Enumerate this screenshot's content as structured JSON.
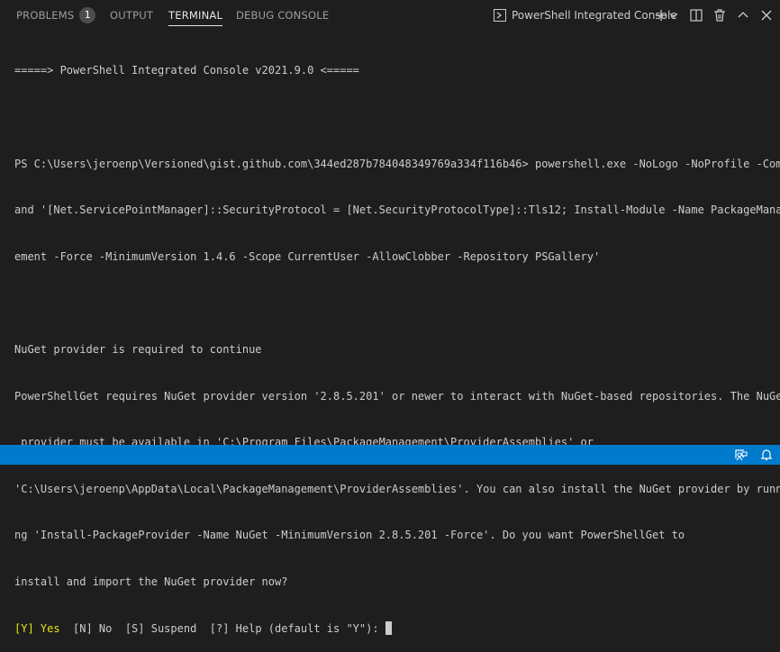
{
  "panel": {
    "tabs": [
      {
        "label": "PROBLEMS",
        "badge": "1"
      },
      {
        "label": "OUTPUT"
      },
      {
        "label": "TERMINAL"
      },
      {
        "label": "DEBUG CONSOLE"
      }
    ],
    "active_tab": "TERMINAL",
    "terminal_select": "PowerShell Integrated Console",
    "actions": [
      "new-terminal-icon",
      "chevron-down-icon",
      "split-terminal-icon",
      "trash-icon",
      "maximize-panel-icon",
      "close-icon"
    ]
  },
  "terminal": {
    "lines": [
      "=====> PowerShell Integrated Console v2021.9.0 <=====",
      "",
      "PS C:\\Users\\jeroenp\\Versioned\\gist.github.com\\344ed287b784048349769a334f116b46> powershell.exe -NoLogo -NoProfile -Comm",
      "and '[Net.ServicePointManager]::SecurityProtocol = [Net.SecurityProtocolType]::Tls12; Install-Module -Name PackageManag",
      "ement -Force -MinimumVersion 1.4.6 -Scope CurrentUser -AllowClobber -Repository PSGallery'",
      "",
      "NuGet provider is required to continue",
      "PowerShellGet requires NuGet provider version '2.8.5.201' or newer to interact with NuGet-based repositories. The NuGet",
      " provider must be available in 'C:\\Program Files\\PackageManagement\\ProviderAssemblies' or",
      "'C:\\Users\\jeroenp\\AppData\\Local\\PackageManagement\\ProviderAssemblies'. You can also install the NuGet provider by runni",
      "ng 'Install-PackageProvider -Name NuGet -MinimumVersion 2.8.5.201 -Force'. Do you want PowerShellGet to",
      "install and import the NuGet provider now?"
    ],
    "prompt": {
      "default_option": "[Y] Yes",
      "other_options": "  [N] No  [S] Suspend  [?] Help (default is \"Y\"): "
    }
  },
  "status_bar": {
    "icons": [
      "feedback-icon",
      "bell-icon"
    ],
    "color": "#007acc"
  },
  "colors": {
    "background": "#1e1e1e",
    "text": "#cccccc",
    "prompt_highlight": "#e5e510"
  }
}
